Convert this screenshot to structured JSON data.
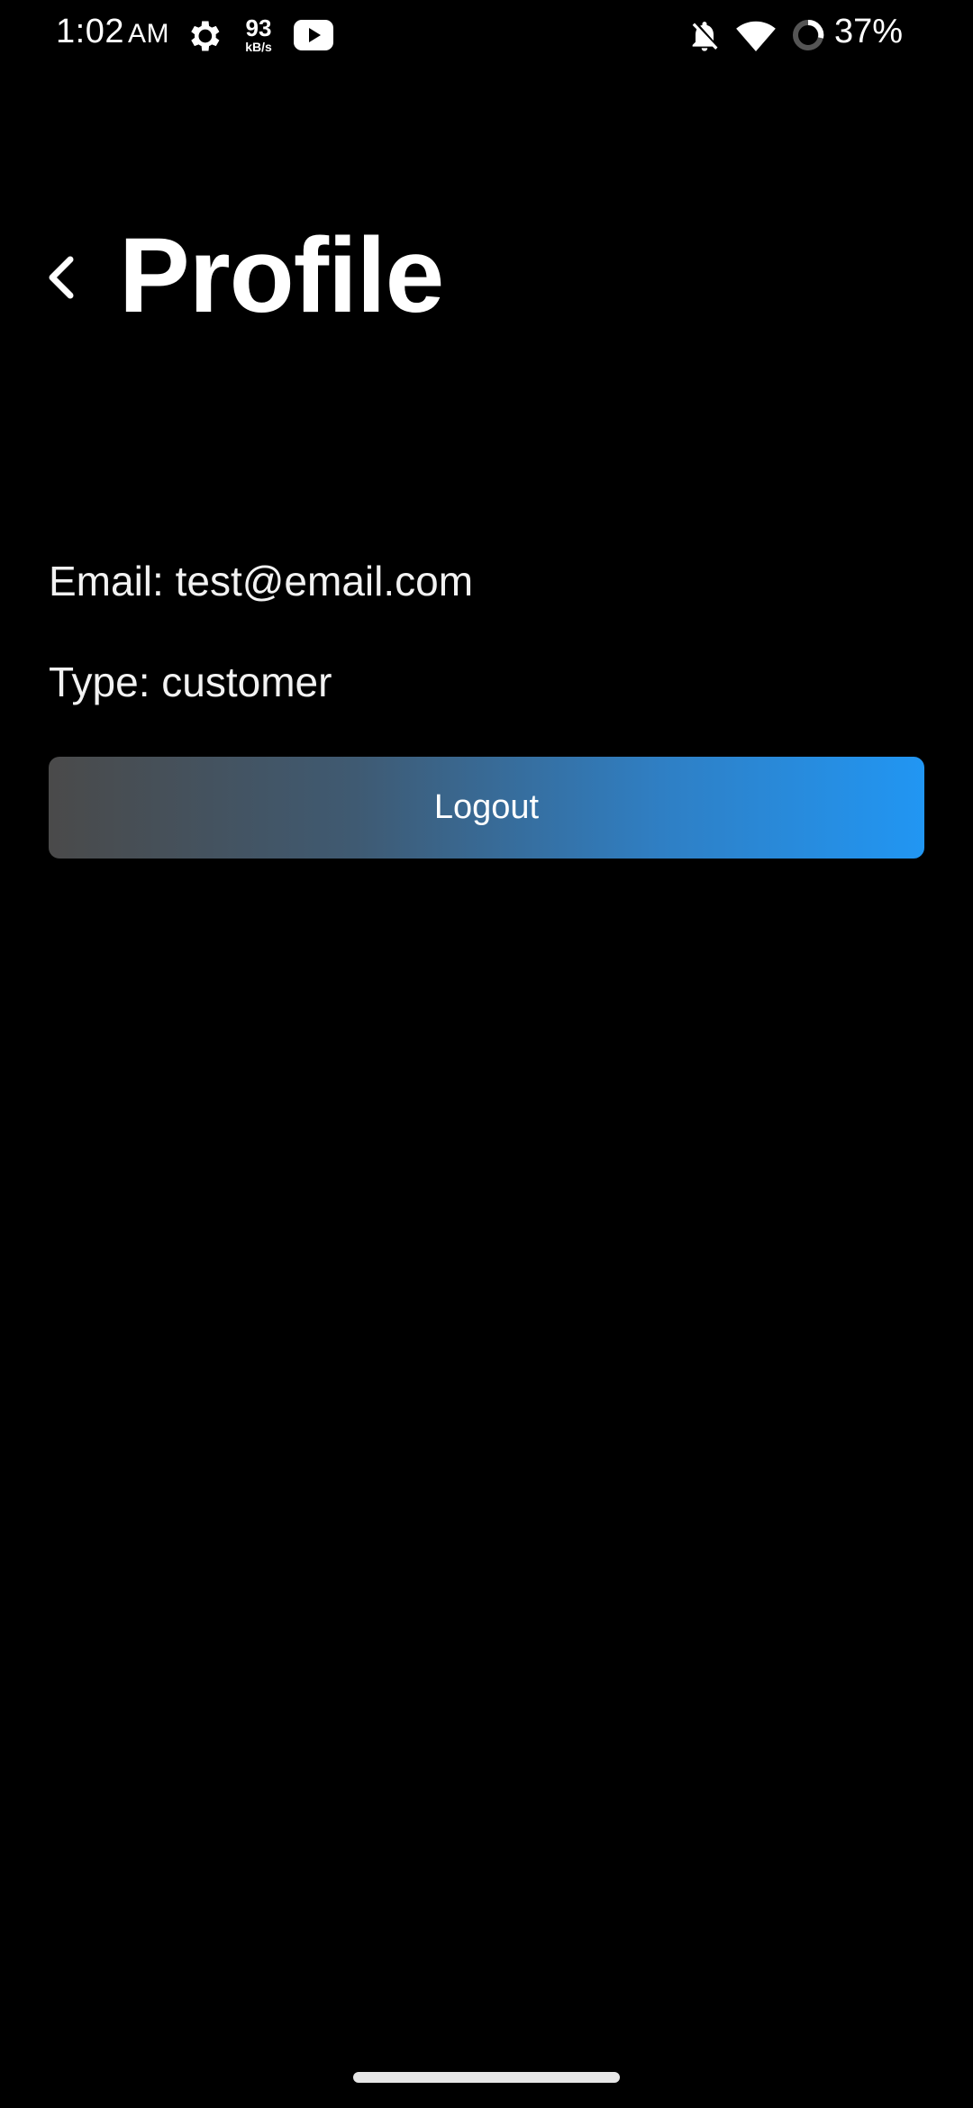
{
  "status_bar": {
    "time": "1:02",
    "ampm": "AM",
    "net_speed_value": "93",
    "net_speed_unit": "kB/s",
    "battery_percent": "37%",
    "icons": [
      "gear-icon",
      "youtube-icon",
      "bell-off-icon",
      "wifi-icon",
      "battery-ring-icon"
    ]
  },
  "header": {
    "title": "Profile",
    "back_icon": "chevron-left-icon"
  },
  "profile": {
    "email_line": "Email: test@email.com",
    "type_line": "Type: customer"
  },
  "actions": {
    "logout_label": "Logout"
  },
  "colors": {
    "background": "#000000",
    "button_gradient_start": "#4a4a4a",
    "button_gradient_end": "#2196f3",
    "text": "#ffffff"
  }
}
